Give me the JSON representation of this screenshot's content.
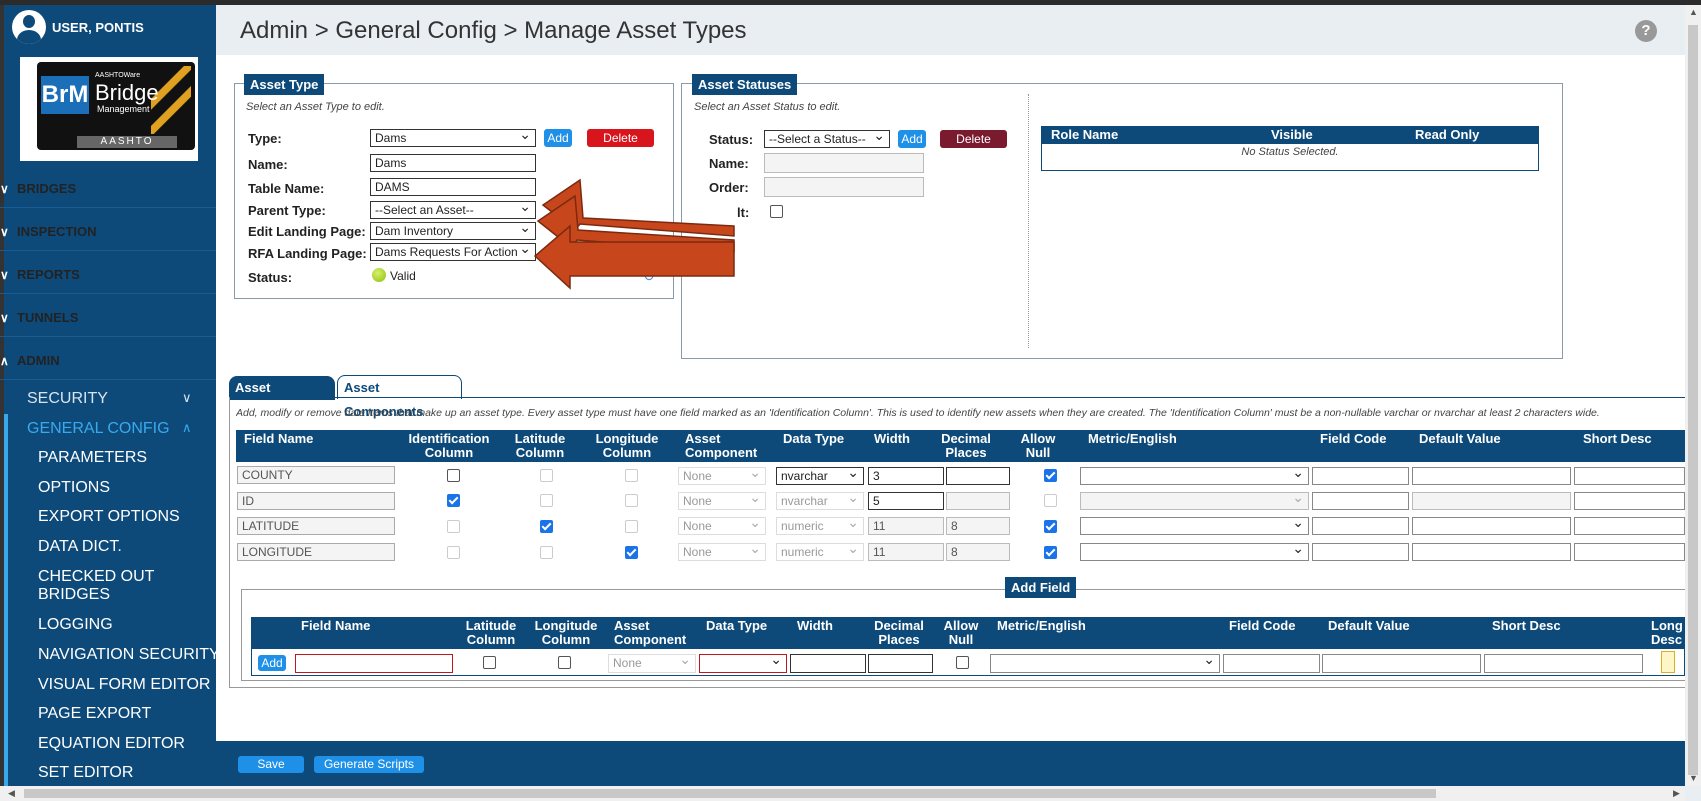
{
  "user": {
    "name": "USER, PONTIS"
  },
  "logo": {
    "brm": "BrM",
    "aashtoware": "AASHTOWare",
    "bridge": "Bridge",
    "management": "Management",
    "aashto": "AASHTO"
  },
  "nav": {
    "main": [
      {
        "label": "BRIDGES",
        "chevron": "chevron-down-icon"
      },
      {
        "label": "INSPECTION",
        "chevron": "chevron-down-icon"
      },
      {
        "label": "REPORTS",
        "chevron": "chevron-down-icon"
      },
      {
        "label": "TUNNELS",
        "chevron": "chevron-down-icon"
      },
      {
        "label": "ADMIN",
        "chevron": "chevron-up-icon"
      }
    ],
    "sub": [
      {
        "label": "SECURITY"
      },
      {
        "label": "GENERAL CONFIG"
      }
    ],
    "leaves": [
      "PARAMETERS",
      "OPTIONS",
      "EXPORT OPTIONS",
      "DATA DICT.",
      "CHECKED OUT BRIDGES",
      "LOGGING",
      "NAVIGATION SECURITY",
      "VISUAL FORM EDITOR",
      "PAGE EXPORT",
      "EQUATION EDITOR",
      "SET EDITOR"
    ]
  },
  "header": {
    "breadcrumb": "Admin > General Config > Manage Asset Types",
    "help": "?"
  },
  "asset_type": {
    "legend": "Asset Type",
    "hint": "Select an Asset Type to edit.",
    "type_label": "Type:",
    "type_value": "Dams",
    "add": "Add",
    "delete": "Delete",
    "name_label": "Name:",
    "name_value": "Dams",
    "table_label": "Table Name:",
    "table_value": "DAMS",
    "parent_label": "Parent Type:",
    "parent_value": "--Select an Asset--",
    "edit_label": "Edit Landing Page:",
    "edit_value": "Dam Inventory",
    "rfa_label": "RFA Landing Page:",
    "rfa_value": "Dams Requests For Action",
    "status_label": "Status:",
    "status_value": "Valid"
  },
  "asset_statuses": {
    "legend": "Asset Statuses",
    "hint": "Select an Asset Status to edit.",
    "status_label": "Status:",
    "status_value": "--Select a Status--",
    "add": "Add",
    "delete": "Delete",
    "name_label": "Name:",
    "order_label": "Order:",
    "default_label": "lt:",
    "roles": {
      "col_role": "Role Name",
      "col_visible": "Visible",
      "col_readonly": "Read Only",
      "empty": "No Status Selected."
    }
  },
  "tabs": [
    "Asset Definition",
    "Asset Components"
  ],
  "definition": {
    "hint": "Add, modify or remove data items that make up an asset type. Every asset type must have one field marked as an 'Identification Column'. This is used to identify new assets when they are created. The 'Identification Column' must be a non-nullable varchar or nvarchar at least 2 characters wide.",
    "columns": [
      "Field Name",
      "Identification Column",
      "Latitude Column",
      "Longitude Column",
      "Asset Component",
      "Data Type",
      "Width",
      "Decimal Places",
      "Allow Null",
      "Metric/English",
      "Field Code",
      "Default Value",
      "Short Desc"
    ],
    "rows": [
      {
        "field": "COUNTY",
        "ident": false,
        "lat": false,
        "lon": false,
        "component": "None",
        "type": "nvarchar",
        "width": "3",
        "decimal": "",
        "allow_null": true
      },
      {
        "field": "ID",
        "ident": true,
        "lat": false,
        "lon": false,
        "component": "None",
        "type": "nvarchar",
        "width": "5",
        "decimal": "",
        "allow_null": false
      },
      {
        "field": "LATITUDE",
        "ident": false,
        "lat": true,
        "lon": false,
        "component": "None",
        "type": "numeric",
        "width": "11",
        "decimal": "8",
        "allow_null": true
      },
      {
        "field": "LONGITUDE",
        "ident": false,
        "lat": false,
        "lon": true,
        "component": "None",
        "type": "numeric",
        "width": "11",
        "decimal": "8",
        "allow_null": true
      }
    ]
  },
  "add_field": {
    "legend": "Add Field",
    "columns": [
      "Field Name",
      "Latitude Column",
      "Longitude Column",
      "Asset Component",
      "Data Type",
      "Width",
      "Decimal Places",
      "Allow Null",
      "Metric/English",
      "Field Code",
      "Default Value",
      "Short Desc",
      "Long Desc"
    ],
    "add": "Add",
    "component": "None"
  },
  "footer": {
    "save": "Save",
    "generate": "Generate Scripts"
  },
  "colors": {
    "navy": "#0d4a7a",
    "accent": "#3aa9ec",
    "delete": "#d8141c",
    "arrow": "#c8461c"
  }
}
